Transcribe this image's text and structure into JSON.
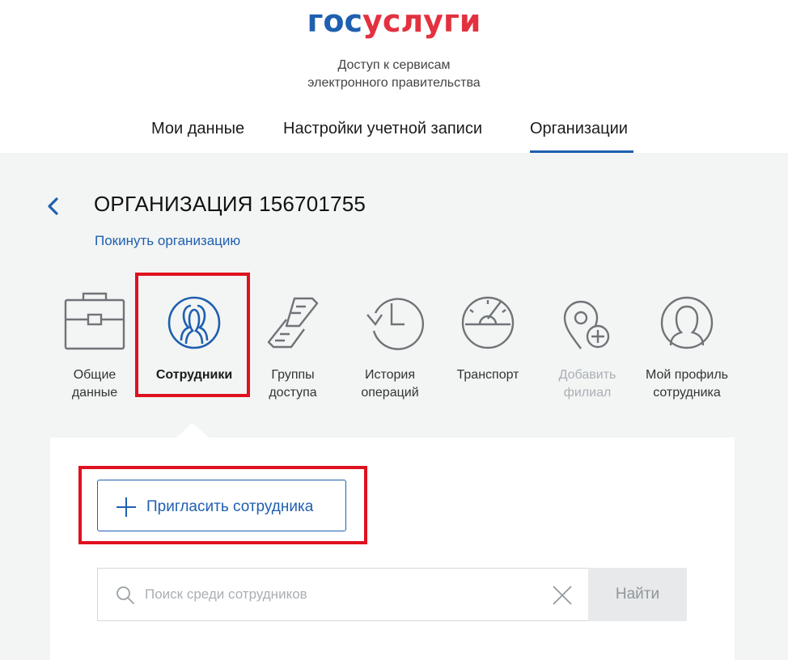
{
  "logo": {
    "part1": "гос",
    "part2": "услуги"
  },
  "tagline": {
    "line1": "Доступ к сервисам",
    "line2": "электронного правительства"
  },
  "tabs": [
    {
      "label": "Мои данные",
      "active": false
    },
    {
      "label": "Настройки учетной записи",
      "active": false
    },
    {
      "label": "Организации",
      "active": true
    }
  ],
  "org": {
    "title": "ОРГАНИЗАЦИЯ 156701755",
    "leave_link": "Покинуть организацию"
  },
  "menu": [
    {
      "label": "Общие данные",
      "line1": "Общие",
      "line2": "данные",
      "icon": "briefcase-icon",
      "active": false,
      "disabled": false
    },
    {
      "label": "Сотрудники",
      "line1": "Сотрудники",
      "line2": "",
      "icon": "employees-icon",
      "active": true,
      "disabled": false
    },
    {
      "label": "Группы доступа",
      "line1": "Группы",
      "line2": "доступа",
      "icon": "chain-link-icon",
      "active": false,
      "disabled": false
    },
    {
      "label": "История операций",
      "line1": "История",
      "line2": "операций",
      "icon": "history-clock-icon",
      "active": false,
      "disabled": false
    },
    {
      "label": "Транспорт",
      "line1": "Транспорт",
      "line2": "",
      "icon": "speedometer-icon",
      "active": false,
      "disabled": false
    },
    {
      "label": "Добавить филиал",
      "line1": "Добавить",
      "line2": "филиал",
      "icon": "add-location-icon",
      "active": false,
      "disabled": true
    },
    {
      "label": "Мой профиль сотрудника",
      "line1": "Мой профиль",
      "line2": "сотрудника",
      "icon": "profile-icon",
      "active": false,
      "disabled": false
    }
  ],
  "invite": {
    "label": "Пригласить сотрудника"
  },
  "search": {
    "placeholder": "Поиск среди сотрудников",
    "value": "",
    "button": "Найти"
  },
  "colors": {
    "brand_blue": "#1f5fb0",
    "brand_red": "#e3313f",
    "highlight": "#e0111f",
    "background": "#f3f5f4"
  }
}
